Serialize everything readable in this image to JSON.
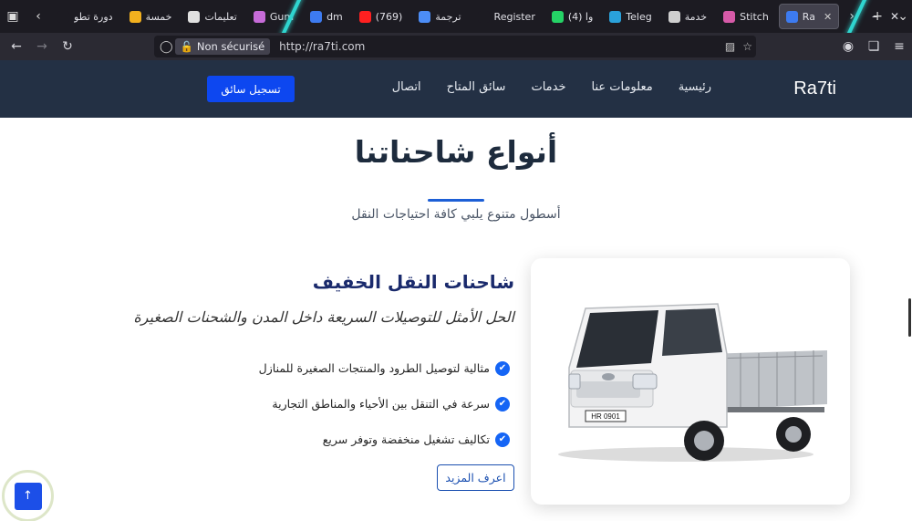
{
  "browser": {
    "tabs": [
      {
        "label": "دورة تطو",
        "color": "#1c1b22",
        "active": false
      },
      {
        "label": "خمسة",
        "color": "#f2b01e",
        "active": false
      },
      {
        "label": "تعليمات",
        "color": "#e0e0e0",
        "active": false
      },
      {
        "label": "Gum",
        "color": "#c66bd8",
        "active": false
      },
      {
        "label": "dm",
        "color": "#3d7bf0",
        "active": false
      },
      {
        "label": "(769)",
        "color": "#ff2020",
        "active": false
      },
      {
        "label": "ترجمة",
        "color": "#4c8df6",
        "active": false
      },
      {
        "label": "Register",
        "color": "#1c1b22",
        "active": false
      },
      {
        "label": "(4) وا",
        "color": "#25d366",
        "active": false
      },
      {
        "label": "Teleg",
        "color": "#2aa1da",
        "active": false
      },
      {
        "label": "خدمة",
        "color": "#cfcfcf",
        "active": false
      },
      {
        "label": "Stitch",
        "color": "#d65aa8",
        "active": false
      },
      {
        "label": "Ra",
        "color": "#3d7bf0",
        "active": true
      }
    ],
    "security_label": "Non sécurisé",
    "url": "http://ra7ti.com"
  },
  "header": {
    "brand": "Ra7ti",
    "menu": [
      "رئيسية",
      "معلومات عنا",
      "خدمات",
      "سائق المتاح",
      "اتصال"
    ],
    "register_button": "تسجيل سائق"
  },
  "section": {
    "title": "أنواع شاحناتنا",
    "subtitle": "أسطول متنوع يلبي كافة احتياجات النقل"
  },
  "truck": {
    "name": "شاحنات النقل الخفيف",
    "tagline": "الحل الأمثل للتوصيلات السريعة داخل المدن والشحنات الصغيرة",
    "features": [
      "مثالية لتوصيل الطرود والمنتجات الصغيرة للمنازل",
      "سرعة في التنقل بين الأحياء والمناطق التجارية",
      "تكاليف تشغيل منخفضة وتوفر سريع"
    ],
    "more_button": "اعرف المزيد",
    "plate": "HR 0901"
  },
  "colors": {
    "header_bg": "#233044",
    "accent": "#0d47f0",
    "title": "#1a2a6c"
  }
}
